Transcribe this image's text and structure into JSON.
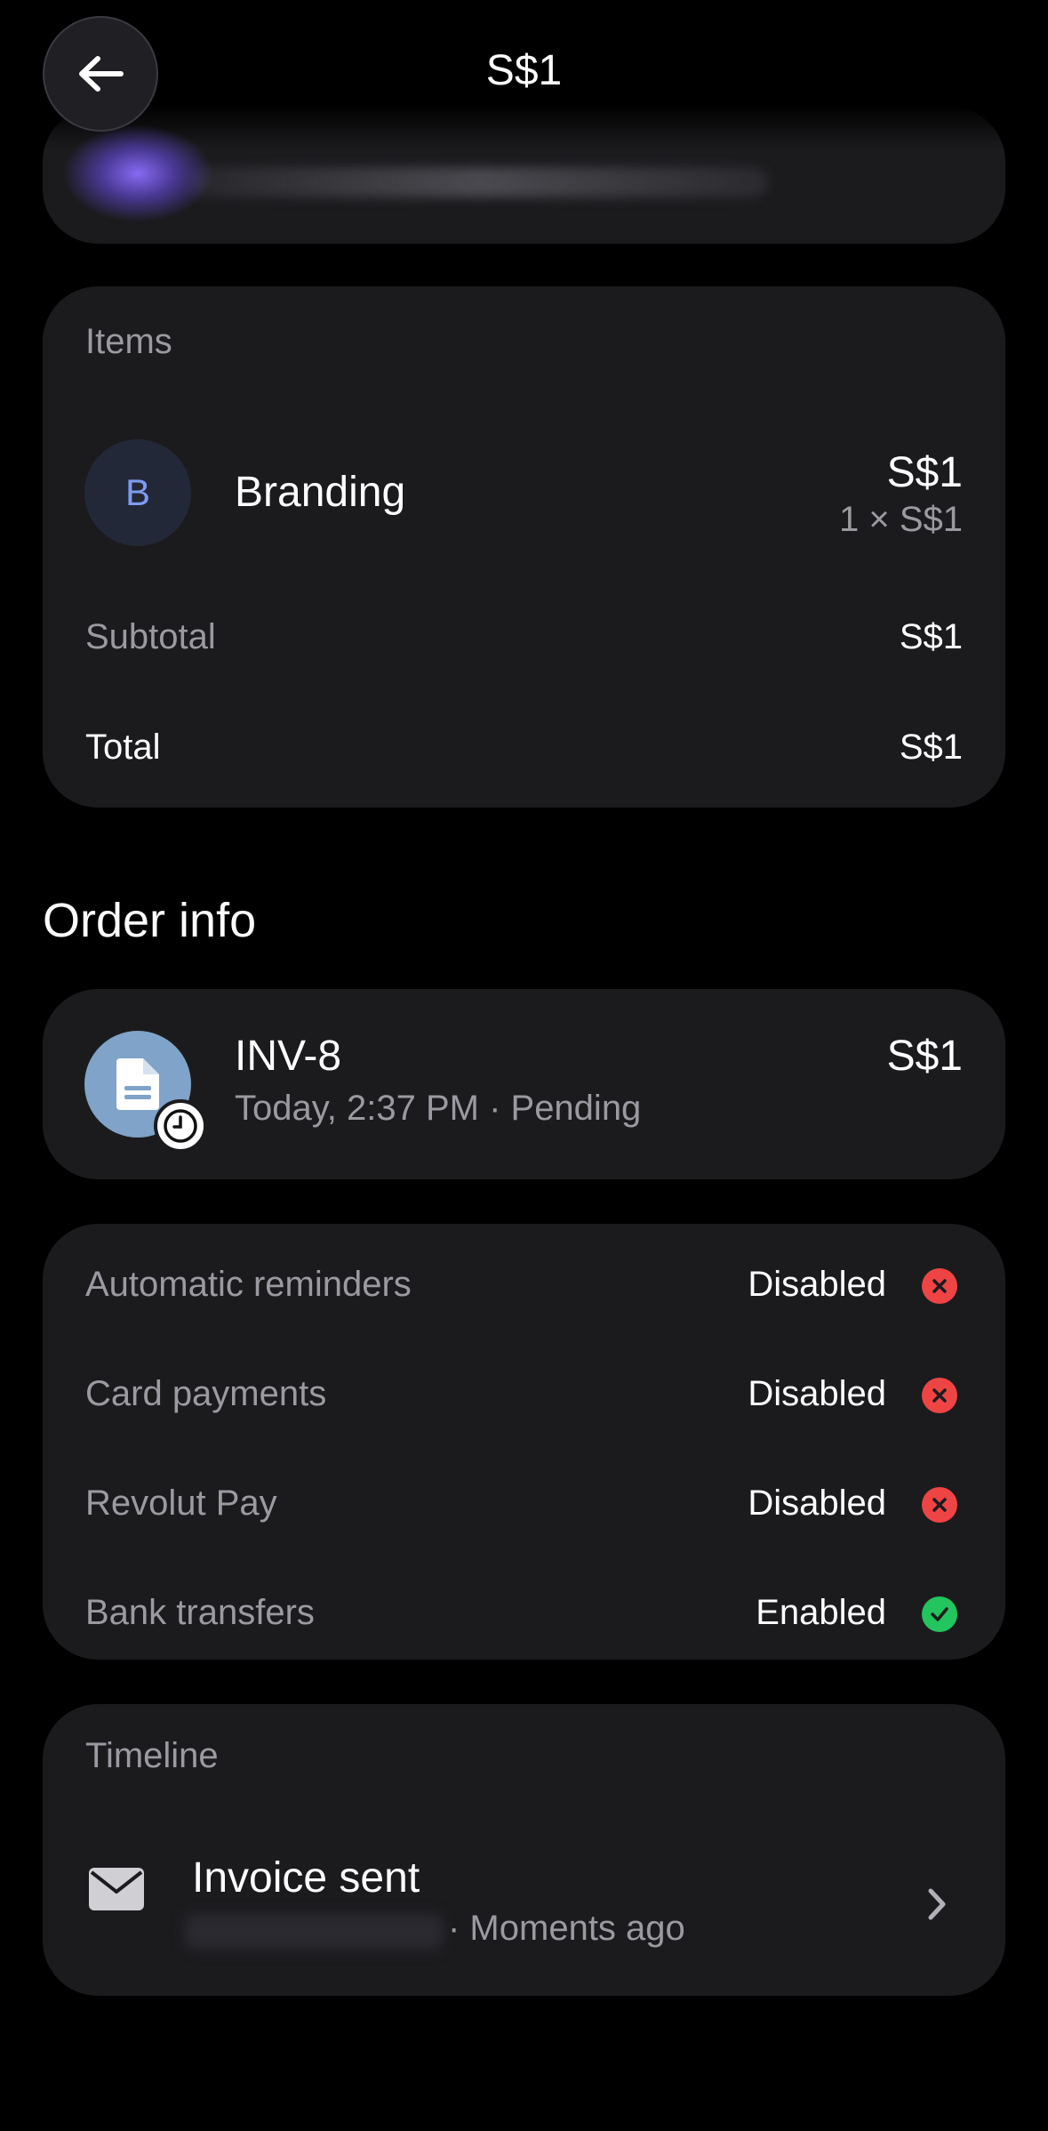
{
  "header": {
    "title": "S$1"
  },
  "items_section": {
    "label": "Items",
    "item": {
      "avatar_letter": "B",
      "name": "Branding",
      "price": "S$1",
      "quantity_line": "1 × S$1"
    },
    "subtotal": {
      "label": "Subtotal",
      "value": "S$1"
    },
    "total": {
      "label": "Total",
      "value": "S$1"
    }
  },
  "order_info": {
    "title": "Order info",
    "invoice": {
      "number": "INV-8",
      "amount": "S$1",
      "meta": "Today, 2:37 PM · Pending",
      "icon": "document-icon",
      "badge_icon": "clock-icon"
    }
  },
  "settings": [
    {
      "label": "Automatic reminders",
      "value": "Disabled",
      "status": "disabled"
    },
    {
      "label": "Card payments",
      "value": "Disabled",
      "status": "disabled"
    },
    {
      "label": "Revolut Pay",
      "value": "Disabled",
      "status": "disabled"
    },
    {
      "label": "Bank transfers",
      "value": "Enabled",
      "status": "enabled"
    }
  ],
  "timeline": {
    "label": "Timeline",
    "event": {
      "title": "Invoice sent",
      "time": "· Moments ago",
      "icon": "mail-icon"
    }
  },
  "colors": {
    "background": "#000000",
    "card": "#1b1b1e",
    "muted_text": "#9a9aa0",
    "disabled_red": "#ef4444",
    "enabled_green": "#22c55e",
    "accent_glow": "#8c6eff",
    "invoice_icon_bg": "#7fa3c9",
    "avatar_letter": "#7d9cf0"
  }
}
